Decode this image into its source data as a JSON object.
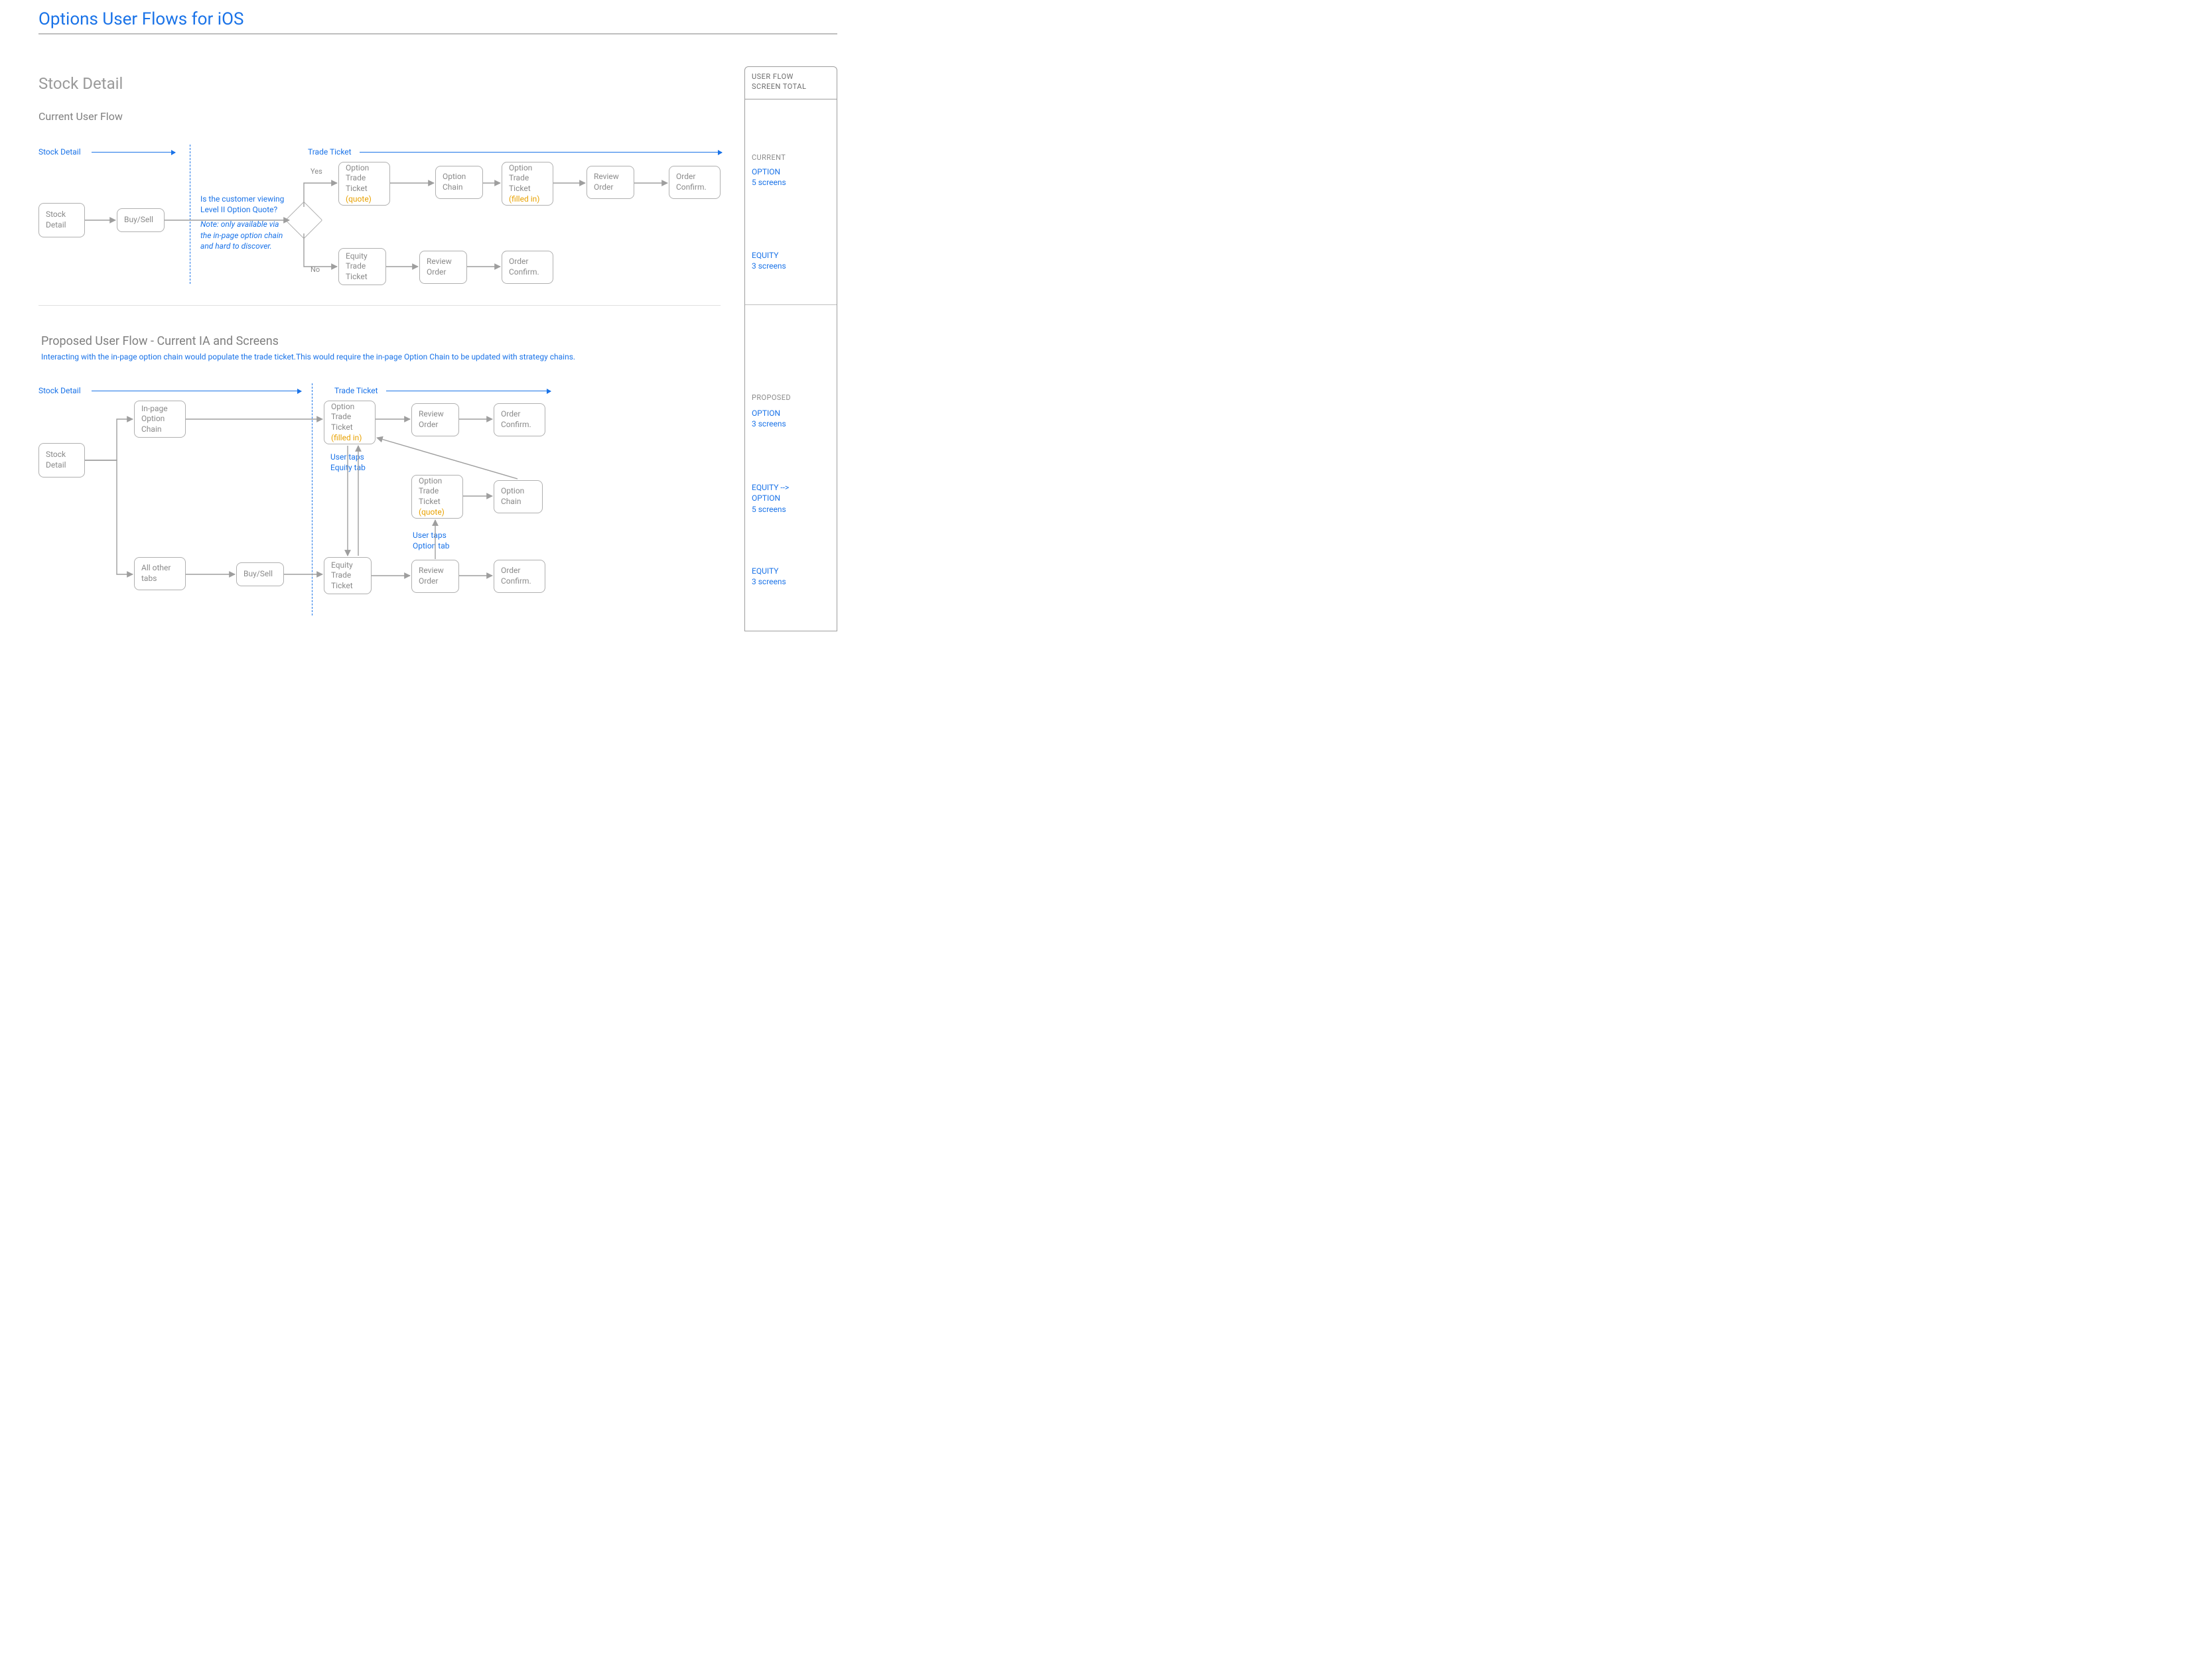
{
  "title": "Options User Flows for iOS",
  "section1": {
    "heading": "Stock Detail",
    "sub": "Current User Flow",
    "lane_stock": "Stock Detail",
    "lane_trade": "Trade Ticket",
    "decision_q": "Is the customer viewing Level II Option Quote?",
    "decision_note": "Note: only available via the in-page option chain and hard to discover.",
    "branch_yes": "Yes",
    "branch_no": "No",
    "nodes": {
      "stock_detail": "Stock\nDetail",
      "buy_sell": "Buy/Sell",
      "ott_quote": {
        "t": "Option\nTrade\nTicket",
        "s": "(quote)"
      },
      "option_chain": "Option\nChain",
      "ott_filled": {
        "t": "Option\nTrade\nTicket",
        "s": "(filled in)"
      },
      "review_order": "Review\nOrder",
      "order_confirm": "Order\nConfirm.",
      "ett": "Equity\nTrade\nTicket",
      "review_order_eq": "Review\nOrder",
      "order_confirm_eq": "Order\nConfirm."
    }
  },
  "section2": {
    "heading": "Proposed User Flow - Current IA and Screens",
    "note": "Interacting with the in-page option chain would populate the trade ticket.This would require the in-page Option Chain to be updated with strategy chains.",
    "lane_stock": "Stock Detail",
    "lane_trade": "Trade Ticket",
    "edge_equity_tab": "User taps\nEquity tab",
    "edge_option_tab": "User taps\nOption tab",
    "nodes": {
      "stock_detail": "Stock\nDetail",
      "inpage_chain": "In-page\nOption\nChain",
      "all_other_tabs": "All other\ntabs",
      "buy_sell": "Buy/Sell",
      "ott_filled": {
        "t": "Option\nTrade\nTicket",
        "s": "(filled in)"
      },
      "review_order_top": "Review\nOrder",
      "order_confirm_top": "Order\nConfirm.",
      "ott_quote": {
        "t": "Option\nTrade\nTicket",
        "s": "(quote)"
      },
      "option_chain": "Option\nChain",
      "ett": "Equity\nTrade\nTicket",
      "review_order_bot": "Review\nOrder",
      "order_confirm_bot": "Order\nConfirm."
    }
  },
  "side": {
    "header_l1": "USER FLOW",
    "header_l2": "SCREEN TOTAL",
    "current_label": "CURRENT",
    "current_option": {
      "label": "OPTION",
      "value": "5 screens"
    },
    "current_equity": {
      "label": "EQUITY",
      "value": "3 screens"
    },
    "proposed_label": "PROPOSED",
    "proposed_option": {
      "label": "OPTION",
      "value": "3 screens"
    },
    "proposed_eq_opt": {
      "label": "EQUITY -->\nOPTION",
      "value": "5 screens"
    },
    "proposed_equity": {
      "label": "EQUITY",
      "value": "3 screens"
    }
  }
}
